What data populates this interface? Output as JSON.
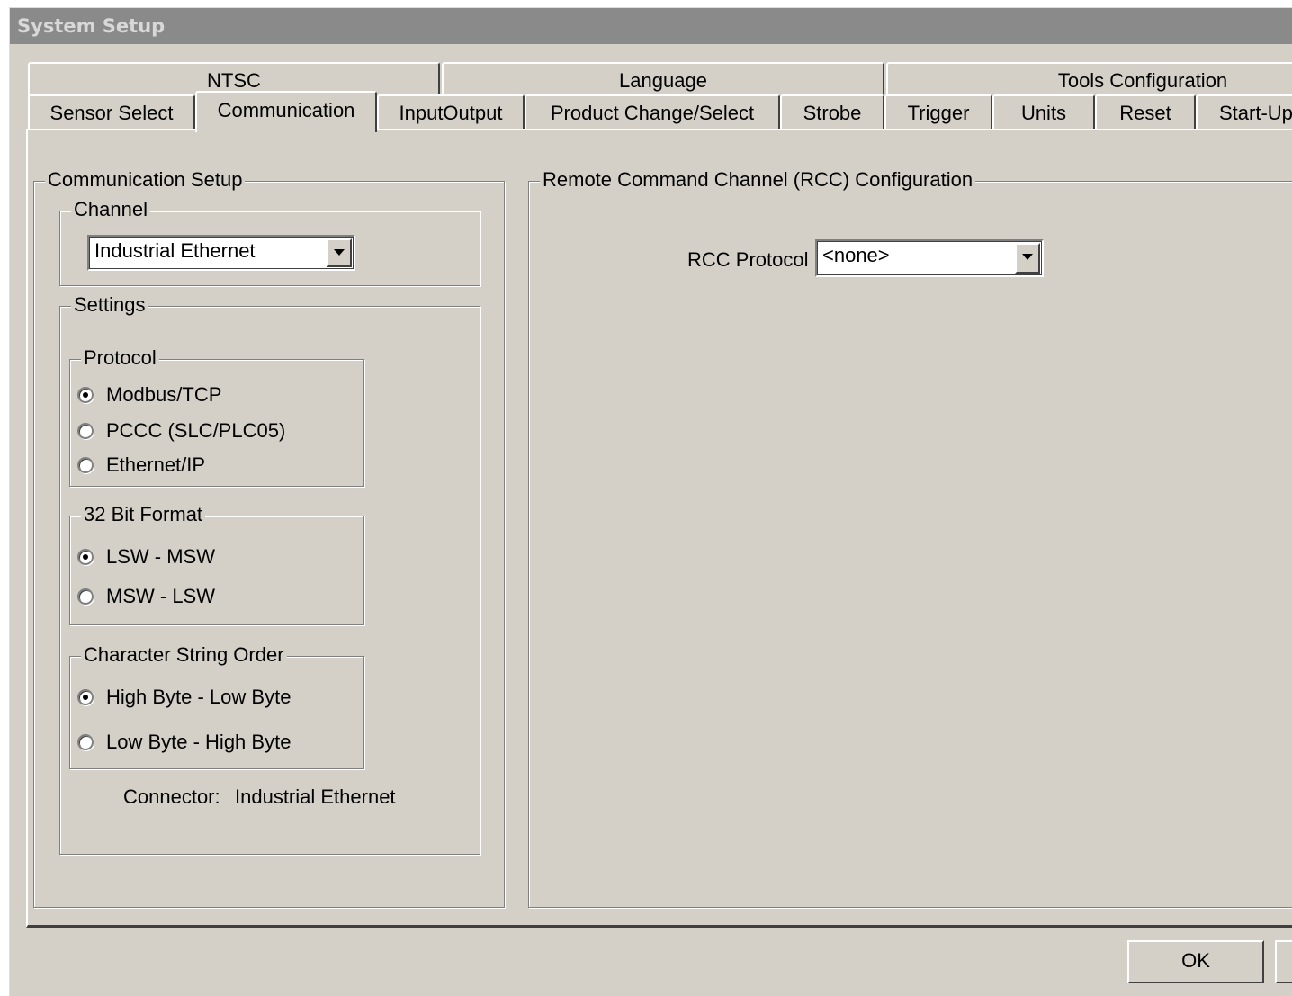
{
  "window": {
    "title": "System Setup"
  },
  "tabs": {
    "row_top": [
      "NTSC",
      "Language",
      "Tools Configuration"
    ],
    "row_bottom": [
      "Sensor Select",
      "Communication",
      "InputOutput",
      "Product Change/Select",
      "Strobe",
      "Trigger",
      "Units",
      "Reset",
      "Start-Up"
    ],
    "active": "Communication"
  },
  "communication_setup": {
    "title": "Communication Setup",
    "channel": {
      "title": "Channel",
      "selected": "Industrial Ethernet"
    },
    "settings": {
      "title": "Settings",
      "protocol": {
        "title": "Protocol",
        "options": [
          "Modbus/TCP",
          "PCCC (SLC/PLC05)",
          "Ethernet/IP"
        ],
        "selected": "Modbus/TCP"
      },
      "bit32_format": {
        "title": "32 Bit Format",
        "options": [
          "LSW - MSW",
          "MSW - LSW"
        ],
        "selected": "LSW - MSW"
      },
      "char_order": {
        "title": "Character String Order",
        "options": [
          "High Byte - Low Byte",
          "Low Byte - High Byte"
        ],
        "selected": "High Byte - Low Byte"
      },
      "connector_label": "Connector:",
      "connector_value": "Industrial Ethernet"
    }
  },
  "rcc": {
    "title": "Remote Command Channel (RCC) Configuration",
    "protocol_label": "RCC Protocol",
    "protocol_value": "<none>"
  },
  "buttons": {
    "ok": "OK"
  }
}
